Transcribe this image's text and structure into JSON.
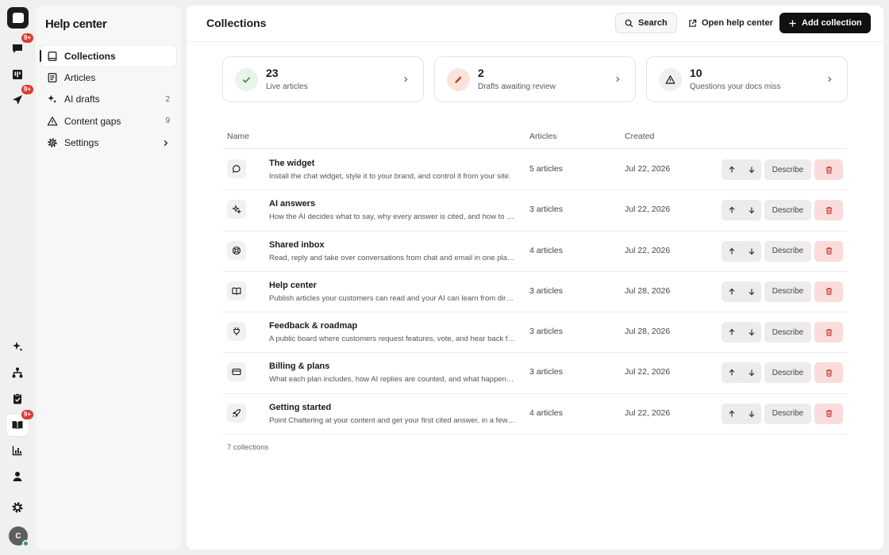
{
  "side_panel": {
    "title": "Help center",
    "nav": [
      {
        "label": "Collections",
        "count": ""
      },
      {
        "label": "Articles",
        "count": ""
      },
      {
        "label": "AI drafts",
        "count": "2"
      },
      {
        "label": "Content gaps",
        "count": "9"
      },
      {
        "label": "Settings",
        "count": ""
      }
    ]
  },
  "rail": {
    "badges": [
      "9+",
      "9+",
      "9+"
    ],
    "avatar_initial": "C"
  },
  "header": {
    "title": "Collections",
    "search_label": "Search",
    "open_label": "Open help center",
    "add_label": "Add collection"
  },
  "stats": [
    {
      "value": "23",
      "label": "Live articles",
      "icon": "check-icon",
      "bg": "#e9f4ea",
      "color": "#2e7d32"
    },
    {
      "value": "2",
      "label": "Drafts awaiting review",
      "icon": "pencil-icon",
      "bg": "#fbe3dc",
      "color": "#c0452c"
    },
    {
      "value": "10",
      "label": "Questions your docs miss",
      "icon": "warning-icon",
      "bg": "#f0f0f0",
      "color": "#1a1a1a"
    }
  ],
  "table": {
    "columns": {
      "name": "Name",
      "articles": "Articles",
      "created": "Created"
    },
    "describe_label": "Describe",
    "rows": [
      {
        "name": "The widget",
        "desc": "Install the chat widget, style it to your brand, and control it from your site.",
        "articles": "5 articles",
        "created": "Jul 22, 2026",
        "icon": "chat-bubble-icon"
      },
      {
        "name": "AI answers",
        "desc": "How the AI decides what to say, why every answer is cited, and how to tune it.",
        "articles": "3 articles",
        "created": "Jul 22, 2026",
        "icon": "sparkles-icon"
      },
      {
        "name": "Shared inbox",
        "desc": "Read, reply and take over conversations from chat and email in one place.",
        "articles": "4 articles",
        "created": "Jul 22, 2026",
        "icon": "lifebuoy-icon"
      },
      {
        "name": "Help center",
        "desc": "Publish articles your customers can read and your AI can learn from directly.",
        "articles": "3 articles",
        "created": "Jul 28, 2026",
        "icon": "book-icon"
      },
      {
        "name": "Feedback & roadmap",
        "desc": "A public board where customers request features, vote, and hear back from you.",
        "articles": "3 articles",
        "created": "Jul 28, 2026",
        "icon": "plug-icon"
      },
      {
        "name": "Billing & plans",
        "desc": "What each plan includes, how AI replies are counted, and what happens at limits.",
        "articles": "3 articles",
        "created": "Jul 22, 2026",
        "icon": "credit-card-icon"
      },
      {
        "name": "Getting started",
        "desc": "Point Chattering at your content and get your first cited answer, in a few minutes.",
        "articles": "4 articles",
        "created": "Jul 22, 2026",
        "icon": "rocket-icon"
      }
    ],
    "footer": "7 collections"
  }
}
